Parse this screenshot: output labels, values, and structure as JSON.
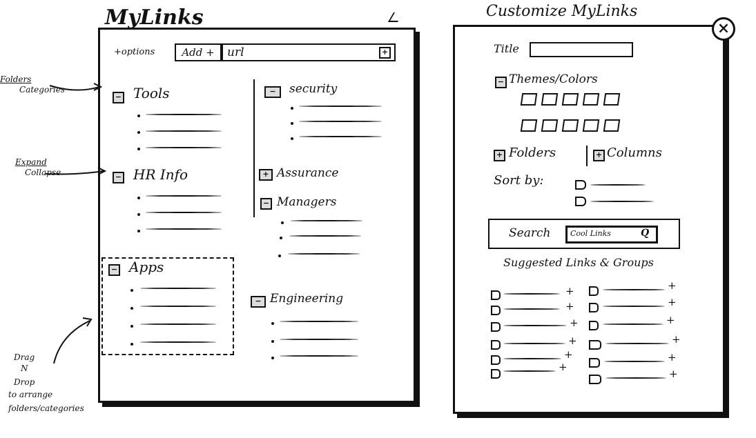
{
  "mylinks": {
    "title": "MyLinks",
    "toolbar": {
      "options_label": "+options",
      "add_label": "Add +",
      "url_value": "url",
      "url_add_glyph": "+"
    },
    "folders": [
      {
        "name": "Tools",
        "state": "expanded",
        "toggle": "−"
      },
      {
        "name": "HR Info",
        "state": "expanded",
        "toggle": "−"
      },
      {
        "name": "Apps",
        "state": "expanded",
        "toggle": "−"
      },
      {
        "name": "security",
        "state": "expanded",
        "toggle": "−"
      },
      {
        "name": "Assurance",
        "state": "collapsed",
        "toggle": "+"
      },
      {
        "name": "Managers",
        "state": "expanded",
        "toggle": "−"
      },
      {
        "name": "Engineering",
        "state": "expanded",
        "toggle": "−"
      }
    ]
  },
  "annotations": {
    "folders": "Folders",
    "categories": "Categories",
    "expand": "Expand",
    "collapse": "Collapse",
    "drag1": "Drag",
    "drag2": "N",
    "drag3": "Drop",
    "drag4": "to arrange",
    "drag5": "folders/categories"
  },
  "customize": {
    "title": "Customize MyLinks",
    "close_glyph": "×",
    "title_label": "Title",
    "title_value": "",
    "themes_label": "Themes/Colors",
    "themes_toggle": "−",
    "folders_label": "Folders",
    "folders_toggle": "+",
    "columns_label": "Columns",
    "columns_toggle": "+",
    "sortby_label": "Sort by:",
    "search_label": "Search",
    "search_value": "Cool Links",
    "search_icon": "Q",
    "suggested_label": "Suggested Links & Groups",
    "suggested_add_glyph": "+",
    "colors": {
      "ink": "#111111",
      "paper": "#ffffff",
      "tab": "#dddddd"
    }
  }
}
